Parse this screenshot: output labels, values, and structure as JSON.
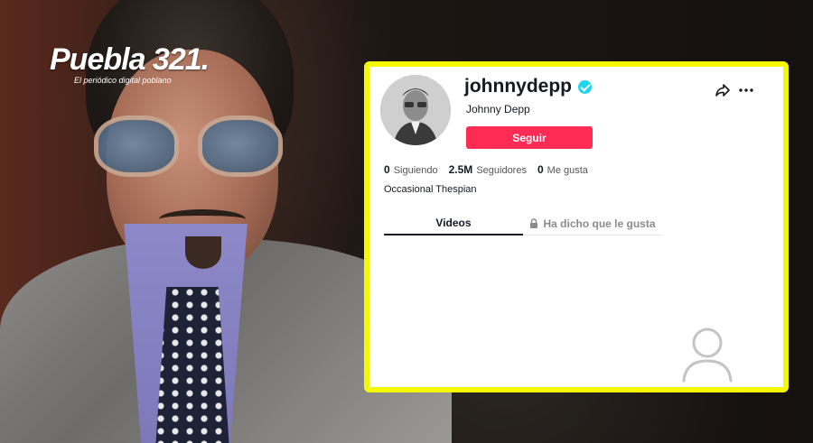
{
  "logo": {
    "main": "Puebla 321.",
    "tagline": "El periódico digital poblano"
  },
  "profile": {
    "username": "johnnydepp",
    "display_name": "Johnny Depp",
    "verified": true,
    "follow_label": "Seguir",
    "stats": [
      {
        "value": "0",
        "label": "Siguiendo"
      },
      {
        "value": "2.5M",
        "label": "Seguidores"
      },
      {
        "value": "0",
        "label": "Me gusta"
      }
    ],
    "bio": "Occasional Thespian"
  },
  "tabs": [
    {
      "label": "Videos",
      "active": true
    },
    {
      "label": "Ha dicho que le gusta",
      "active": false,
      "icon": "lock-icon"
    }
  ],
  "colors": {
    "card_border": "#f5f900",
    "follow_button": "#fe2c55",
    "verified_badge": "#20d5ec"
  },
  "icons": [
    "share-icon",
    "more-icon",
    "verified-icon",
    "lock-icon",
    "user-placeholder-icon"
  ]
}
